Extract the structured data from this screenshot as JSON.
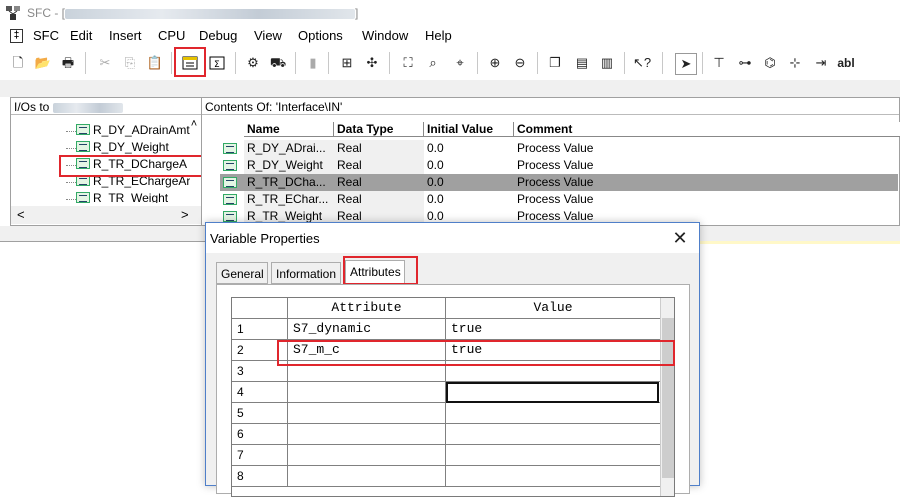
{
  "window": {
    "title_prefix": "SFC - [",
    "title_suffix": "]"
  },
  "menu": {
    "items": [
      "SFC",
      "Edit",
      "Insert",
      "CPU",
      "Debug",
      "View",
      "Options",
      "Window",
      "Help"
    ]
  },
  "left_pane": {
    "header": "I/Os to",
    "items": [
      "R_DY_ADrainAmt",
      "R_DY_Weight",
      "R_TR_DChargeA",
      "R_TR_EChargeAr",
      "R_TR_Weight"
    ]
  },
  "right_pane": {
    "header": "Contents Of: 'Interface\\IN'",
    "columns": [
      "Name",
      "Data Type",
      "Initial Value",
      "Comment"
    ],
    "rows": [
      {
        "name": "R_DY_ADrai...",
        "type": "Real",
        "initial": "0.0",
        "comment": "Process Value"
      },
      {
        "name": "R_DY_Weight",
        "type": "Real",
        "initial": "0.0",
        "comment": "Process Value"
      },
      {
        "name": "R_TR_DCha...",
        "type": "Real",
        "initial": "0.0",
        "comment": "Process Value"
      },
      {
        "name": "R_TR_EChar...",
        "type": "Real",
        "initial": "0.0",
        "comment": "Process Value"
      },
      {
        "name": "R_TR_Weight",
        "type": "Real",
        "initial": "0.0",
        "comment": "Process Value"
      }
    ]
  },
  "dialog": {
    "title": "Variable Properties",
    "tabs": [
      "General",
      "Information",
      "Attributes"
    ],
    "active_tab": "Attributes",
    "grid": {
      "columns": [
        "Attribute",
        "Value"
      ],
      "rows": [
        {
          "num": "1",
          "attribute": "S7_dynamic",
          "value": "true"
        },
        {
          "num": "2",
          "attribute": "S7_m_c",
          "value": "true"
        },
        {
          "num": "3",
          "attribute": "",
          "value": ""
        },
        {
          "num": "4",
          "attribute": "",
          "value": ""
        },
        {
          "num": "5",
          "attribute": "",
          "value": ""
        },
        {
          "num": "6",
          "attribute": "",
          "value": ""
        },
        {
          "num": "7",
          "attribute": "",
          "value": ""
        },
        {
          "num": "8",
          "attribute": "",
          "value": ""
        }
      ]
    }
  },
  "colors": {
    "highlight_red": "#e0262d",
    "selected_row": "#a0a0a0",
    "dialog_border": "#4f7fc9"
  }
}
